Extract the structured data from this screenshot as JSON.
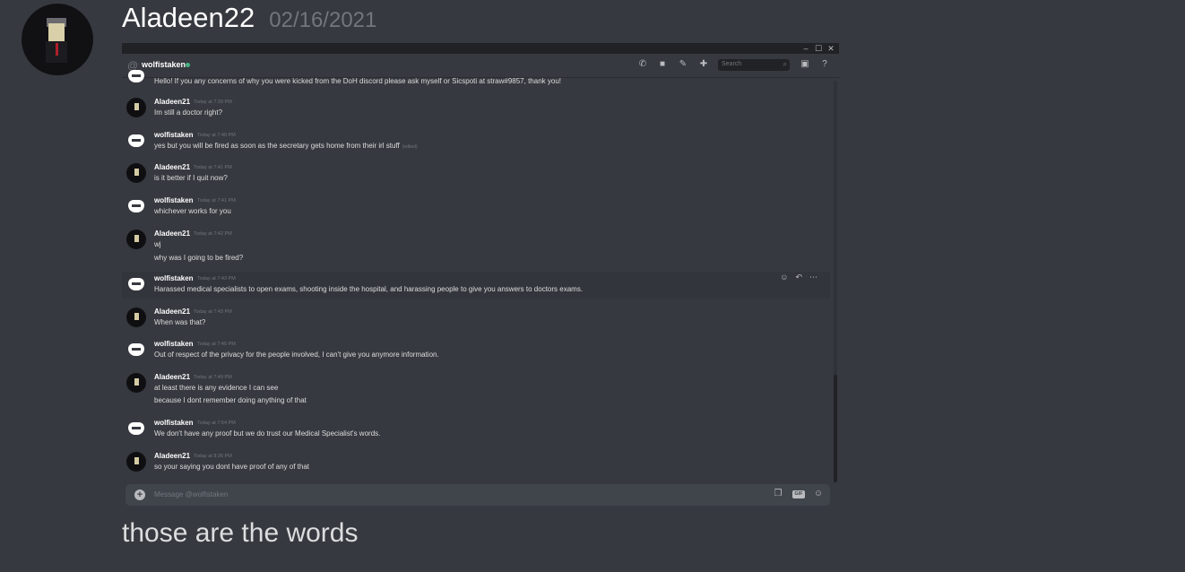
{
  "post": {
    "username": "Aladeen22",
    "timestamp": "02/16/2021",
    "caption": "those are the words"
  },
  "screenshot": {
    "window_controls": [
      "–",
      "☐",
      "✕"
    ],
    "channel": {
      "at_symbol": "@",
      "name": "wolfistaken",
      "status": "online"
    },
    "toolbar": {
      "search_placeholder": "Search",
      "icons": [
        "phone-icon",
        "video-icon",
        "pin-icon",
        "add-member-icon",
        "inbox-icon",
        "help-icon"
      ]
    },
    "messages": [
      {
        "author": "",
        "time": "",
        "lines": [
          "Hello! If you any concerns of why you were kicked from the DoH discord please ask myself or Sicspoti at straw#9857, thank you!"
        ],
        "avatar": "wolf"
      },
      {
        "author": "Aladeen21",
        "time": "Today at 7:39 PM",
        "lines": [
          "Im still a doctor right?"
        ],
        "avatar": "ala"
      },
      {
        "author": "wolfistaken",
        "time": "Today at 7:40 PM",
        "lines": [
          "yes but you will be fired as soon as the secretary gets home from their irl stuff"
        ],
        "edited": "(edited)",
        "avatar": "wolf"
      },
      {
        "author": "Aladeen21",
        "time": "Today at 7:41 PM",
        "lines": [
          "is it better if I quit now?"
        ],
        "avatar": "ala"
      },
      {
        "author": "wolfistaken",
        "time": "Today at 7:41 PM",
        "lines": [
          "whichever works for you"
        ],
        "avatar": "wolf"
      },
      {
        "author": "Aladeen21",
        "time": "Today at 7:42 PM",
        "lines": [
          "wj",
          "why was I going to be fired?"
        ],
        "avatar": "ala"
      },
      {
        "author": "wolfistaken",
        "time": "Today at 7:43 PM",
        "lines": [
          "Harassed medical specialists to open exams, shooting inside the hospital, and harassing people to give you answers to doctors exams."
        ],
        "avatar": "wolf",
        "highlighted": true
      },
      {
        "author": "Aladeen21",
        "time": "Today at 7:43 PM",
        "lines": [
          "When was that?"
        ],
        "avatar": "ala"
      },
      {
        "author": "wolfistaken",
        "time": "Today at 7:45 PM",
        "lines": [
          "Out of respect of the privacy for the people involved, I can't give you anymore information."
        ],
        "avatar": "wolf"
      },
      {
        "author": "Aladeen21",
        "time": "Today at 7:49 PM",
        "lines": [
          "at least there is any evidence I can see",
          "because I dont remember doing anything of that"
        ],
        "avatar": "ala"
      },
      {
        "author": "wolfistaken",
        "time": "Today at 7:54 PM",
        "lines": [
          "We don't have any proof but we do trust our Medical Specialist's words."
        ],
        "avatar": "wolf"
      },
      {
        "author": "Aladeen21",
        "time": "Today at 8:26 PM",
        "lines": [
          "so your saying you dont have proof of any of that"
        ],
        "avatar": "ala"
      }
    ],
    "hover_tools": [
      "add-reaction-icon",
      "reply-icon",
      "more-icon"
    ],
    "composer": {
      "placeholder": "Message @wolfistaken",
      "gif_label": "GIF",
      "icons": [
        "attach-plus-icon",
        "gift-icon",
        "gif-icon",
        "emoji-icon"
      ]
    }
  }
}
